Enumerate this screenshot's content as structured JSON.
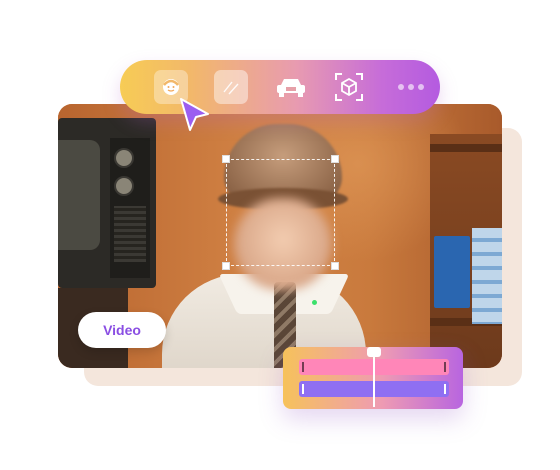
{
  "toolbar": {
    "tools": [
      {
        "name": "face-blur",
        "icon": "face-icon"
      },
      {
        "name": "mosaic",
        "icon": "blur-stripes-icon"
      },
      {
        "name": "license-plate",
        "icon": "car-icon"
      },
      {
        "name": "object",
        "icon": "box-target-icon"
      },
      {
        "name": "more",
        "icon": "more-dots-icon"
      }
    ],
    "active_tool": "face-blur"
  },
  "media_label": "Video",
  "colors": {
    "accent": "#8a4ee3",
    "toolbar_start": "#f7cc55",
    "toolbar_end": "#b45be0",
    "track_pink": "#ff86b8",
    "track_purple": "#8f6ff2"
  },
  "timeline": {
    "tracks": [
      "pink-track",
      "purple-track"
    ]
  }
}
